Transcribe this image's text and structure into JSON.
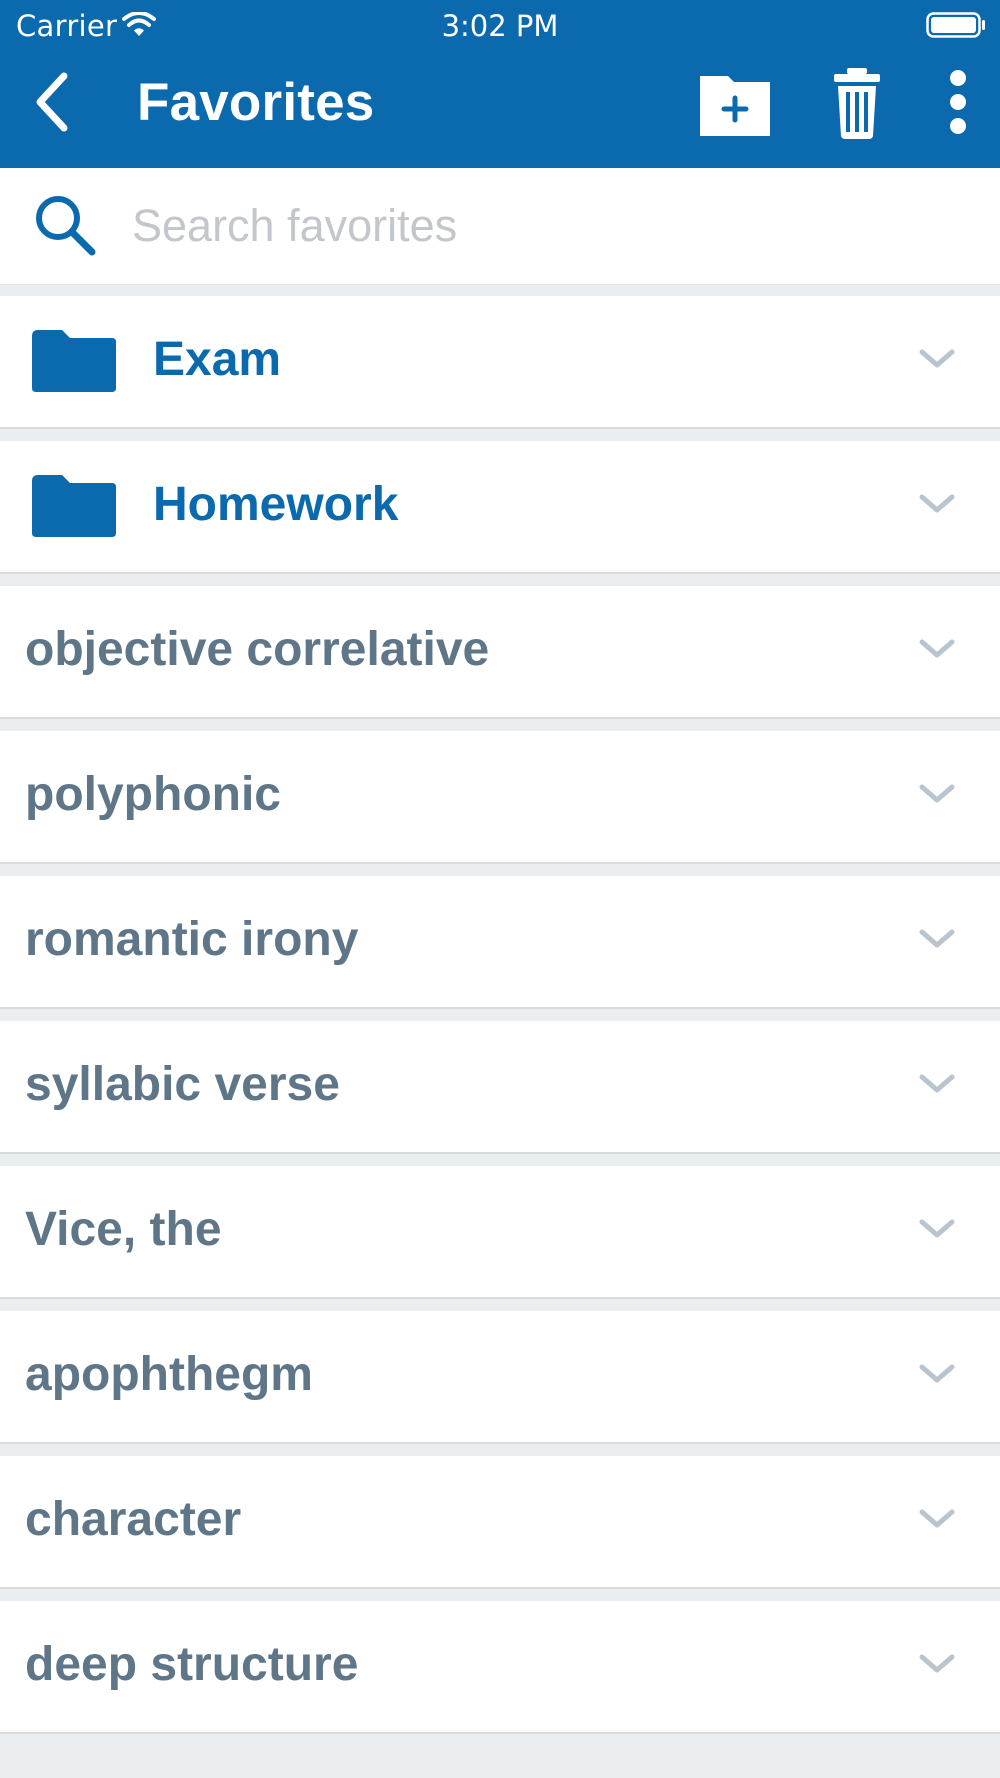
{
  "status_bar": {
    "carrier": "Carrier",
    "time": "3:02 PM"
  },
  "header": {
    "title": "Favorites"
  },
  "search": {
    "placeholder": "Search favorites",
    "value": ""
  },
  "folders": [
    {
      "label": "Exam"
    },
    {
      "label": "Homework"
    }
  ],
  "terms": [
    {
      "label": "objective correlative"
    },
    {
      "label": "polyphonic"
    },
    {
      "label": "romantic irony"
    },
    {
      "label": "syllabic verse"
    },
    {
      "label": "Vice, the"
    },
    {
      "label": "apophthegm"
    },
    {
      "label": "character"
    },
    {
      "label": "deep structure"
    }
  ],
  "colors": {
    "header_bg": "#0b69ae",
    "folder_text": "#0b69ae",
    "term_text": "#5f7689",
    "chevron": "#b8c4ce",
    "placeholder": "#c3c7cb"
  },
  "icons": {
    "back": "chevron-left-icon",
    "new_folder": "folder-plus-icon",
    "delete": "trash-icon",
    "more": "more-vertical-icon",
    "search": "search-icon",
    "folder": "folder-icon",
    "expand": "chevron-down-icon"
  }
}
